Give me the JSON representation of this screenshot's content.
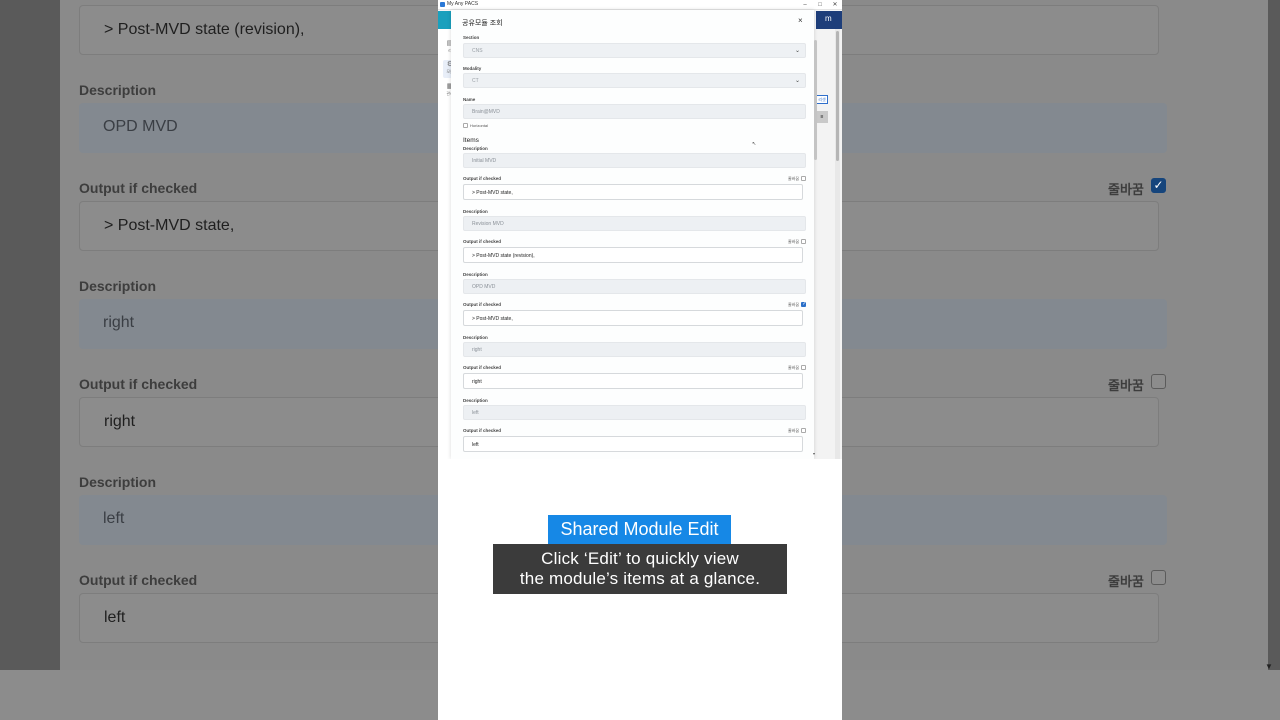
{
  "background": {
    "rows": [
      {
        "kind": "edit",
        "text": "> Post-MVD state (revision),"
      },
      {
        "kind": "label",
        "text": "Description"
      },
      {
        "kind": "readonly",
        "text": "OPD MVD"
      },
      {
        "kind": "label",
        "text": "Output if checked",
        "checkbox_label": "줄바꿈",
        "checked": true
      },
      {
        "kind": "edit",
        "text": "> Post-MVD state,"
      },
      {
        "kind": "label",
        "text": "Description"
      },
      {
        "kind": "readonly",
        "text": "right"
      },
      {
        "kind": "label",
        "text": "Output if checked",
        "checkbox_label": "줄바꿈",
        "checked": false
      },
      {
        "kind": "edit",
        "text": "right"
      },
      {
        "kind": "label",
        "text": "Description"
      },
      {
        "kind": "readonly",
        "text": "left"
      },
      {
        "kind": "label",
        "text": "Output if checked",
        "checkbox_label": "줄바꿈",
        "checked": false
      },
      {
        "kind": "edit",
        "text": "left"
      }
    ],
    "scroll_arrow": "▼"
  },
  "window": {
    "title": "My Any PACS",
    "controls": {
      "minimize": "–",
      "maximize": "□",
      "close": "✕"
    },
    "nav": [
      {
        "icon": "▤",
        "label": "리"
      },
      {
        "icon": "⚙",
        "label": "모듈"
      },
      {
        "icon": "▦",
        "label": "관리"
      }
    ],
    "user_initial": "m",
    "bg_button_a": "리셋",
    "bg_button_b": "≡"
  },
  "modal": {
    "title": "공유모듈 조회",
    "close": "×",
    "section_label": "Section",
    "section_value": "CNS",
    "modality_label": "Modality",
    "modality_value": "CT",
    "name_label": "Name",
    "name_value": "Brain@MVD",
    "horizontal_label": "Horizontal",
    "items_heading": "Items",
    "linebreak_label": "줄바꿈",
    "description_label": "Description",
    "output_label": "Output if checked",
    "items": [
      {
        "description": "Initial MVD",
        "output": "> Post-MVD state,",
        "linebreak": false
      },
      {
        "description": "Revision MVD",
        "output": "> Post-MVD state (revision),",
        "linebreak": false
      },
      {
        "description": "OPD MVD",
        "output": "> Post-MVD state,",
        "linebreak": true
      },
      {
        "description": "right",
        "output": "right",
        "linebreak": false
      },
      {
        "description": "left",
        "output": "left",
        "linebreak": false
      }
    ],
    "scroll_arrow": "▾",
    "cursor": "↖"
  },
  "caption": {
    "title": "Shared Module Edit",
    "line1": "Click ‘Edit’ to quickly view",
    "line2": "the module’s items at a glance."
  },
  "colors": {
    "accent": "#1688e6",
    "teal": "#1aa0bd",
    "navy": "#1e3e7a",
    "checked": "#2b70c9"
  }
}
